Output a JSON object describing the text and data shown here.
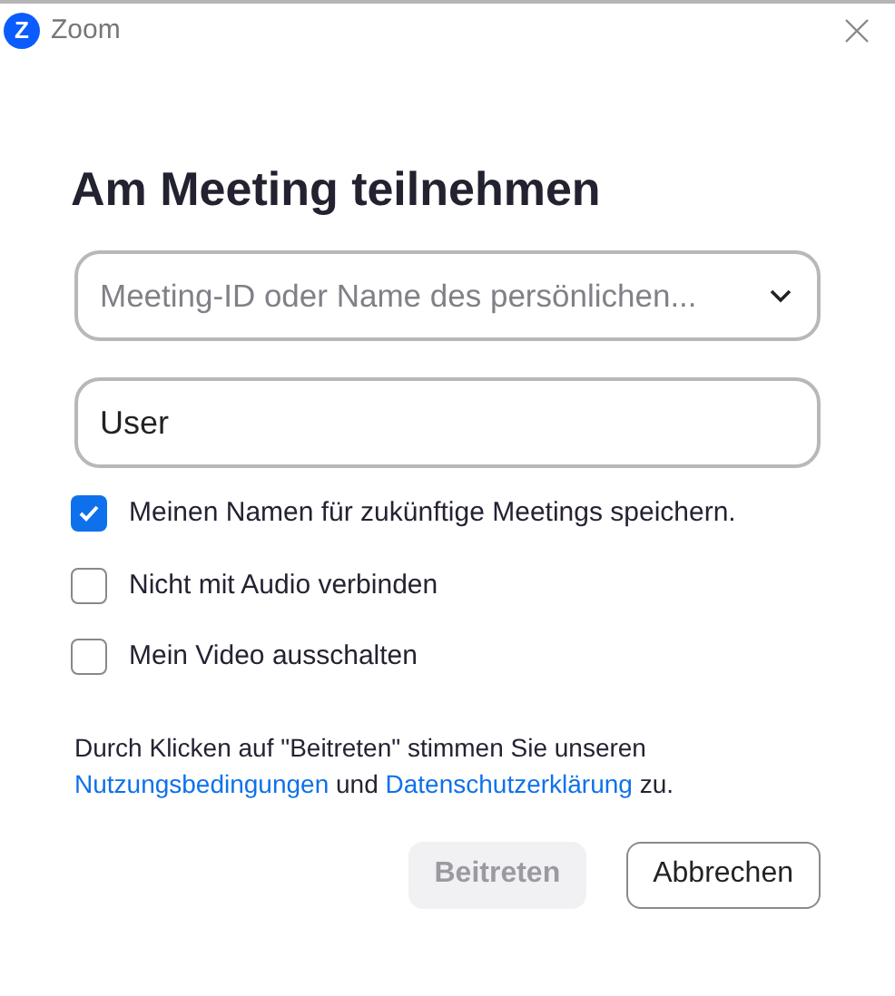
{
  "window": {
    "logo": "Z",
    "title": "Zoom"
  },
  "heading": "Am Meeting teilnehmen",
  "meeting_field": {
    "placeholder": "Meeting-ID oder Name des persönlichen..."
  },
  "name_field": {
    "value": "User"
  },
  "options": [
    {
      "label": "Meinen Namen für zukünftige Meetings speichern.",
      "checked": true
    },
    {
      "label": "Nicht mit Audio verbinden",
      "checked": false
    },
    {
      "label": "Mein Video ausschalten",
      "checked": false
    }
  ],
  "disclaimer": {
    "before": "Durch Klicken auf \"Beitreten\" stimmen Sie unseren",
    "link_1": "Nutzungsbedingungen",
    "middle": "und",
    "link_2": "Datenschutzerklärung",
    "after": "zu."
  },
  "buttons": [
    {
      "label": "Beitreten",
      "kind": "primary",
      "disabled": true
    },
    {
      "label": "Abbrechen",
      "kind": "secondary",
      "disabled": false
    }
  ]
}
